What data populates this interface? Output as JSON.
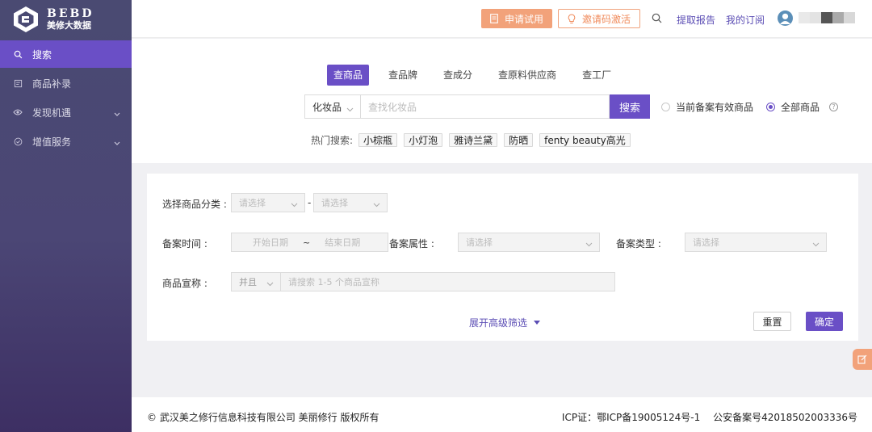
{
  "brand": {
    "title": "BEBD",
    "subtitle": "美修大数据"
  },
  "sidebar": {
    "items": [
      {
        "label": "搜索",
        "icon": "search-icon",
        "active": true
      },
      {
        "label": "商品补录",
        "icon": "document-icon"
      },
      {
        "label": "发现机遇",
        "icon": "eye-icon",
        "expandable": true
      },
      {
        "label": "增值服务",
        "icon": "check-circle-icon",
        "expandable": true
      }
    ]
  },
  "header": {
    "trial_label": "申请试用",
    "invite_label": "邀请码激活",
    "links": [
      "提取报告",
      "我的订阅"
    ]
  },
  "search": {
    "tabs": [
      "查商品",
      "查品牌",
      "查成分",
      "查原料供应商",
      "查工厂"
    ],
    "category": "化妆品",
    "placeholder": "查找化妆品",
    "button": "搜索",
    "radio_options": [
      "当前备案有效商品",
      "全部商品"
    ],
    "radio_selected": "全部商品",
    "help": "?",
    "hot_label": "热门搜索:",
    "hot_tags": [
      "小棕瓶",
      "小灯泡",
      "雅诗兰黛",
      "防晒",
      "fenty beauty高光"
    ]
  },
  "filters": {
    "category_label": "选择商品分类 :",
    "category_placeholder_1": "请选择",
    "category_placeholder_2": "请选择",
    "dash": "-",
    "record_time_label": "备案时间 :",
    "start_date": "开始日期",
    "tilde": "~",
    "end_date": "结束日期",
    "record_attr_label": "备案属性 :",
    "record_attr_placeholder": "请选择",
    "record_type_label": "备案类型 :",
    "record_type_placeholder": "请选择",
    "claim_label": "商品宣称 :",
    "claim_logic": "并且",
    "claim_placeholder": "请搜索 1-5 个商品宣称",
    "expand_label": "展开高级筛选",
    "reset_label": "重置",
    "confirm_label": "确定"
  },
  "footer": {
    "copyright": "© 武汉美之修行信息科技有限公司 美丽修行 版权所有",
    "icp": "ICP证：鄂ICP备19005124号-1",
    "police": "公安备案号42018502003336号"
  },
  "colors": {
    "primary": "#6a4fc6",
    "accent": "#f2a27a",
    "sidebar": "#4a4a72"
  }
}
